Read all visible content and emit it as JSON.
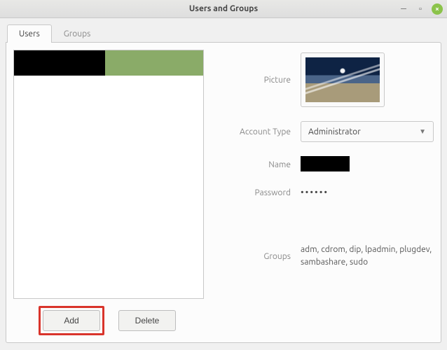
{
  "window": {
    "title": "Users and Groups"
  },
  "tabs": {
    "users": "Users",
    "groups": "Groups"
  },
  "buttons": {
    "add": "Add",
    "delete": "Delete"
  },
  "labels": {
    "picture": "Picture",
    "account_type": "Account Type",
    "name": "Name",
    "password": "Password",
    "groups": "Groups"
  },
  "details": {
    "account_type": "Administrator",
    "password_mask": "••••••",
    "groups": "adm, cdrom, dip, lpadmin, plugdev, sambashare, sudo"
  }
}
